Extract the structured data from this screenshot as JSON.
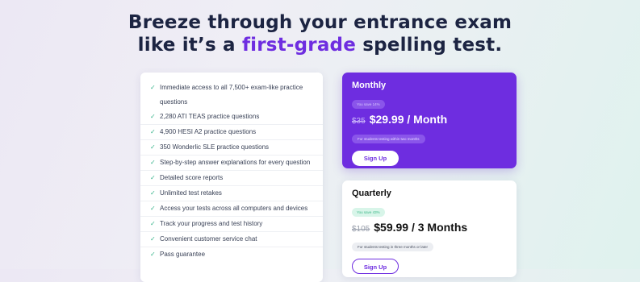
{
  "hero": {
    "line1": "Breeze through your entrance exam",
    "line2_prefix": "like it’s a ",
    "line2_accent": "first-grade",
    "line2_suffix": " spelling test."
  },
  "features": {
    "check_icon": "check-icon",
    "items": [
      "Immediate access to all 7,500+ exam-like practice questions",
      "2,280 ATI TEAS practice questions",
      "4,900 HESI A2 practice questions",
      "350 Wonderlic SLE practice questions",
      "Step-by-step answer explanations for every question",
      "Detailed score reports",
      "Unlimited test retakes",
      "Access your tests across all computers and devices",
      "Track your progress and test history",
      "Convenient customer service chat",
      "Pass guarantee"
    ]
  },
  "plans": {
    "monthly": {
      "name": "Monthly",
      "save": "You save 14%",
      "old_price": "$35",
      "price": "$29.99 / Month",
      "note": "For students testing within two months",
      "cta": "Sign Up"
    },
    "quarterly": {
      "name": "Quarterly",
      "save": "You save 43%",
      "old_price": "$105",
      "price": "$59.99 / 3 Months",
      "note": "For students testing in three months or later",
      "cta": "Sign Up"
    }
  },
  "colors": {
    "accent": "#6e2de0",
    "check": "#38b48b",
    "heading": "#1c2442"
  }
}
